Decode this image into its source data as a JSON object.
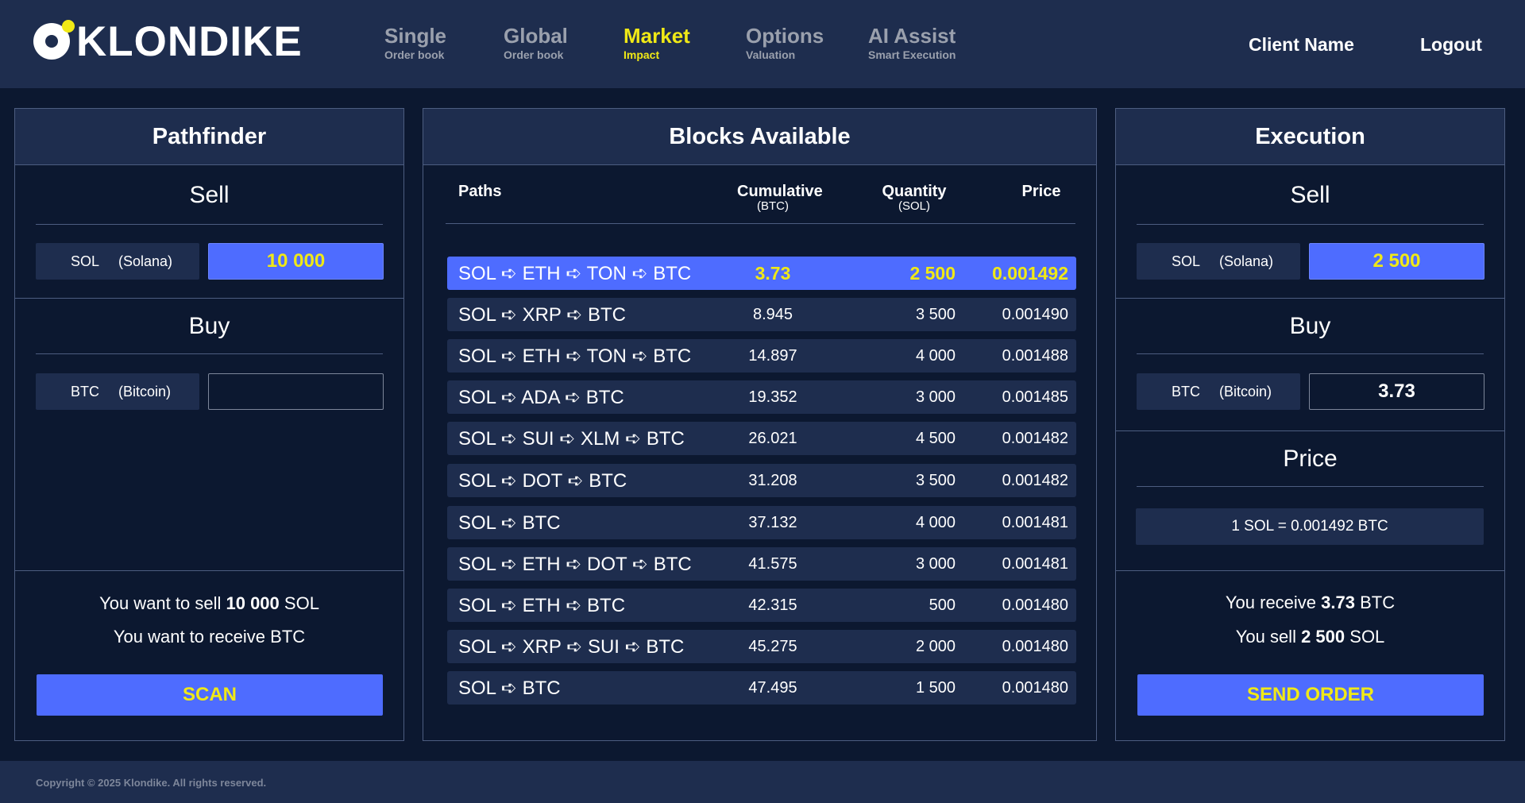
{
  "brand": {
    "name": "KLONDIKE"
  },
  "nav": [
    {
      "title": "Single",
      "sub": "Order book"
    },
    {
      "title": "Global",
      "sub": "Order book"
    },
    {
      "title": "Market",
      "sub": "Impact",
      "active": true
    },
    {
      "title": "Options",
      "sub": "Valuation"
    },
    {
      "title": "AI Assist",
      "sub": "Smart Execution"
    }
  ],
  "header": {
    "client": "Client Name",
    "logout": "Logout"
  },
  "pathfinder": {
    "title": "Pathfinder",
    "sell_title": "Sell",
    "sell_symbol": "SOL",
    "sell_name": "(Solana)",
    "sell_amount": "10 000",
    "buy_title": "Buy",
    "buy_symbol": "BTC",
    "buy_name": "(Bitcoin)",
    "buy_amount": "",
    "summary_sell_prefix": "You want to sell",
    "summary_sell_amount": "10 000",
    "summary_sell_unit": "SOL",
    "summary_receive": "You want to receive BTC",
    "scan_label": "SCAN"
  },
  "blocks": {
    "title": "Blocks Available",
    "headers": {
      "paths": "Paths",
      "cumulative": "Cumulative",
      "cumulative_unit": "(BTC)",
      "quantity": "Quantity",
      "quantity_unit": "(SOL)",
      "price": "Price"
    },
    "rows": [
      {
        "path": "SOL ➪ ETH ➪ TON ➪ BTC",
        "cumulative": "3.73",
        "quantity": "2 500",
        "price": "0.001492",
        "selected": true
      },
      {
        "path": "SOL ➪ XRP ➪ BTC",
        "cumulative": "8.945",
        "quantity": "3 500",
        "price": "0.001490"
      },
      {
        "path": "SOL ➪ ETH ➪ TON ➪ BTC",
        "cumulative": "14.897",
        "quantity": "4 000",
        "price": "0.001488"
      },
      {
        "path": "SOL ➪ ADA ➪ BTC",
        "cumulative": "19.352",
        "quantity": "3 000",
        "price": "0.001485"
      },
      {
        "path": "SOL ➪  SUI  ➪ XLM ➪ BTC",
        "cumulative": "26.021",
        "quantity": "4 500",
        "price": "0.001482"
      },
      {
        "path": "SOL ➪ DOT ➪ BTC",
        "cumulative": "31.208",
        "quantity": "3 500",
        "price": "0.001482"
      },
      {
        "path": "SOL ➪ BTC",
        "cumulative": "37.132",
        "quantity": "4 000",
        "price": "0.001481"
      },
      {
        "path": "SOL ➪ ETH ➪ DOT ➪ BTC",
        "cumulative": "41.575",
        "quantity": "3 000",
        "price": "0.001481"
      },
      {
        "path": "SOL ➪ ETH ➪ BTC",
        "cumulative": "42.315",
        "quantity": "500",
        "price": "0.001480"
      },
      {
        "path": "SOL ➪ XRP ➪  SUI  ➪ BTC",
        "cumulative": "45.275",
        "quantity": "2 000",
        "price": "0.001480"
      },
      {
        "path": "SOL ➪ BTC",
        "cumulative": "47.495",
        "quantity": "1 500",
        "price": "0.001480"
      }
    ]
  },
  "execution": {
    "title": "Execution",
    "sell_title": "Sell",
    "sell_symbol": "SOL",
    "sell_name": "(Solana)",
    "sell_amount": "2 500",
    "buy_title": "Buy",
    "buy_symbol": "BTC",
    "buy_name": "(Bitcoin)",
    "buy_amount": "3.73",
    "price_title": "Price",
    "price_value": "1 SOL = 0.001492 BTC",
    "receive_prefix": "You receive",
    "receive_amount": "3.73",
    "receive_unit": "BTC",
    "sell_prefix": "You sell",
    "sell_summary_amount": "2 500",
    "sell_summary_unit": "SOL",
    "send_label": "SEND ORDER"
  },
  "footer": {
    "copyright": "Copyright © 2025 Klondike. All rights reserved."
  },
  "colors": {
    "accent": "#4e6cff",
    "highlight": "#f0e916",
    "panel": "#1e2d4e",
    "background": "#0c1830"
  }
}
